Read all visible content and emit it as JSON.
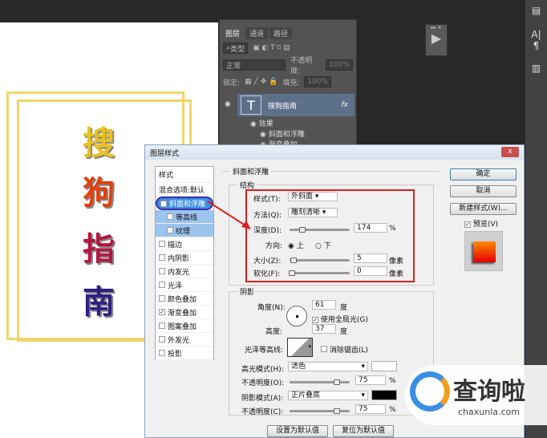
{
  "canvas": {
    "chars": [
      "搜",
      "狗",
      "指",
      "南"
    ],
    "char_colors": [
      "#e8c020",
      "#e04010",
      "#b01840",
      "#302080"
    ],
    "frame_color": "#f1d56a"
  },
  "layers_panel": {
    "tabs": [
      "图层",
      "通道",
      "路径"
    ],
    "filter_label": "类型",
    "blend_mode": "正常",
    "opacity_label": "不透明度:",
    "opacity_value": "100%",
    "lock_label": "锁定:",
    "fill_label": "填充:",
    "fill_value": "100%",
    "layer_name": "搜狗指南",
    "layer_fx": "fx",
    "effects_label": "效果",
    "effect_1": "斜面和浮雕",
    "effect_2": "渐变叠加"
  },
  "dialog": {
    "title": "图层样式",
    "close": "x",
    "styles_header": "样式",
    "blend_options": "混合选项:默认",
    "styles": [
      {
        "label": "斜面和浮雕",
        "checked": true
      },
      {
        "label": "等高线",
        "checked": false
      },
      {
        "label": "纹理",
        "checked": false
      },
      {
        "label": "描边",
        "checked": false
      },
      {
        "label": "内阴影",
        "checked": false
      },
      {
        "label": "内发光",
        "checked": false
      },
      {
        "label": "光泽",
        "checked": false
      },
      {
        "label": "颜色叠加",
        "checked": false
      },
      {
        "label": "渐变叠加",
        "checked": true
      },
      {
        "label": "图案叠加",
        "checked": false
      },
      {
        "label": "外发光",
        "checked": false
      },
      {
        "label": "投影",
        "checked": false
      }
    ],
    "section_title": "斜面和浮雕",
    "structure_title": "结构",
    "style_label": "样式(T):",
    "style_value": "外斜面",
    "method_label": "方法(Q):",
    "method_value": "雕刻清晰",
    "depth_label": "深度(D):",
    "depth_value": "174",
    "depth_pct": "%",
    "direction_label": "方向:",
    "dir_up": "上",
    "dir_down": "下",
    "size_label": "大小(Z):",
    "size_value": "5",
    "size_unit": "像素",
    "soften_label": "软化(F):",
    "soften_value": "0",
    "soften_unit": "像素",
    "shading_title": "阴影",
    "angle_label": "角度(N):",
    "angle_value": "61",
    "angle_unit": "度",
    "global_light": "使用全局光(G)",
    "altitude_label": "高度:",
    "altitude_value": "37",
    "altitude_unit": "度",
    "gloss_label": "光泽等高线:",
    "antialias": "消除锯齿(L)",
    "highlight_label": "高光模式(H):",
    "highlight_value": "滤色",
    "highlight_color": "#ffffff",
    "hl_opacity_label": "不透明度(O):",
    "hl_opacity_value": "75",
    "shadow_label": "阴影模式(A):",
    "shadow_value": "正片叠底",
    "shadow_color": "#000000",
    "sh_opacity_label": "不透明度(C):",
    "sh_opacity_value": "75",
    "pct": "%",
    "make_default": "设置为默认值",
    "reset_default": "复位为默认值",
    "ok": "确定",
    "cancel": "取消",
    "new_style": "新建样式(W)...",
    "preview": "预览(V)"
  },
  "watermark": {
    "text": "查询啦",
    "url": "chaxunla.com"
  }
}
